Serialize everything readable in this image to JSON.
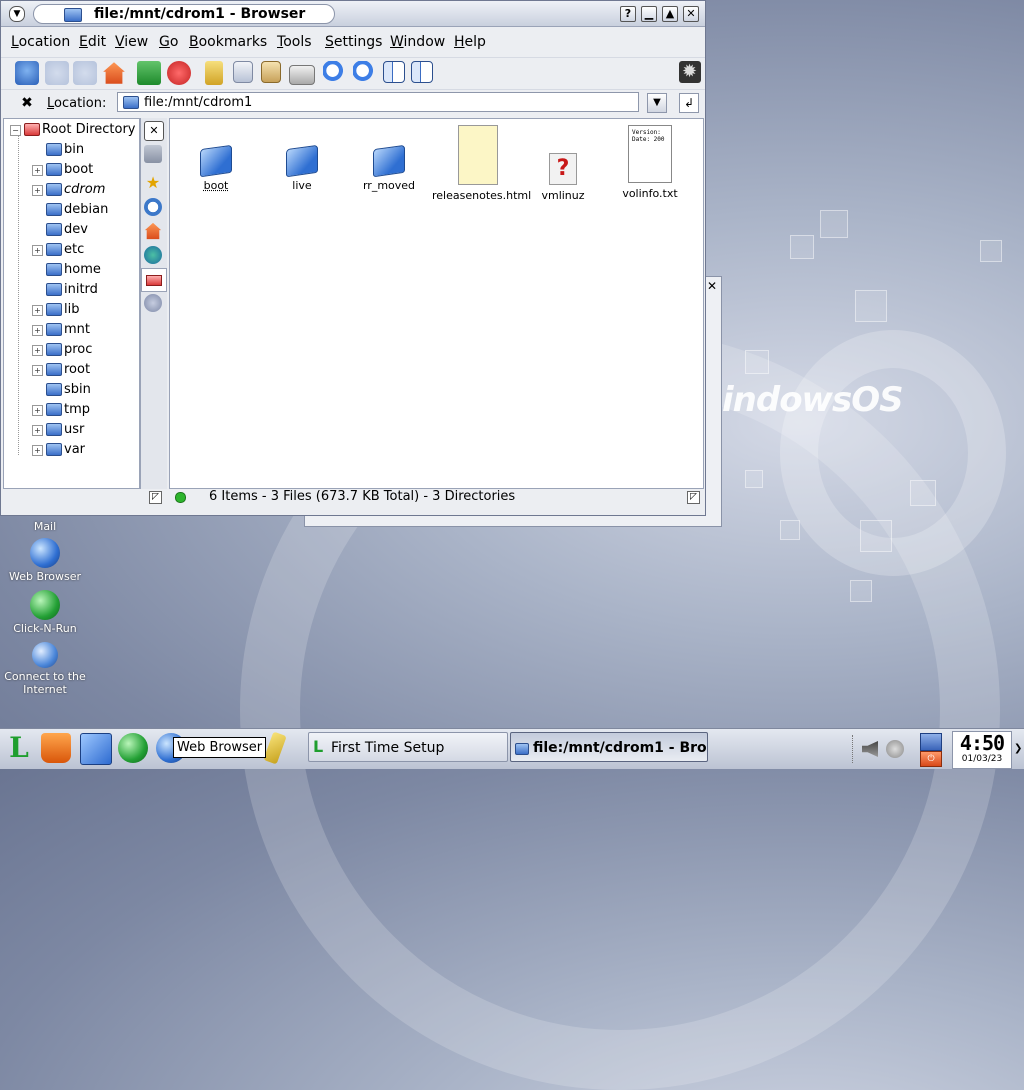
{
  "window": {
    "title": "file:/mnt/cdrom1 - Browser",
    "menu": [
      "Location",
      "Edit",
      "View",
      "Go",
      "Bookmarks",
      "Tools",
      "Settings",
      "Window",
      "Help"
    ]
  },
  "toolbar": {
    "icons": [
      "up-icon",
      "back-icon",
      "forward-icon",
      "home-icon",
      "reload-icon",
      "stop-icon",
      "cut-icon",
      "copy-icon",
      "paste-icon",
      "print-icon",
      "zoom-in-icon",
      "zoom-out-icon",
      "icon-view-icon",
      "detail-view-icon",
      "throbber-icon"
    ]
  },
  "location": {
    "label": "Location:",
    "value": "file:/mnt/cdrom1"
  },
  "tree": {
    "root": "Root Directory",
    "items": [
      "bin",
      "boot",
      "cdrom",
      "debian",
      "dev",
      "etc",
      "home",
      "initrd",
      "lib",
      "mnt",
      "proc",
      "root",
      "sbin",
      "tmp",
      "usr",
      "var"
    ]
  },
  "files": [
    {
      "name": "boot",
      "kind": "folder"
    },
    {
      "name": "live",
      "kind": "folder"
    },
    {
      "name": "rr_moved",
      "kind": "folder"
    },
    {
      "name": "releasenotes.html",
      "kind": "html"
    },
    {
      "name": "vmlinuz",
      "kind": "binary"
    },
    {
      "name": "volinfo.txt",
      "kind": "text",
      "preview": "Version:\nDate: 200"
    }
  ],
  "status": {
    "text": "6 Items - 3 Files (673.7 KB Total) - 3 Directories"
  },
  "desktop": {
    "brand": "indowsOS",
    "icons": [
      {
        "label": "Mail"
      },
      {
        "label": "Web Browser"
      },
      {
        "label": "Click-N-Run"
      },
      {
        "label": "Connect to the Internet"
      }
    ]
  },
  "taskbar": {
    "tooltip": "Web Browser",
    "tasks": [
      "First Time Setup",
      "file:/mnt/cdrom1 - Browser"
    ],
    "clock": {
      "time": "4:50",
      "date": "01/03/23"
    }
  }
}
